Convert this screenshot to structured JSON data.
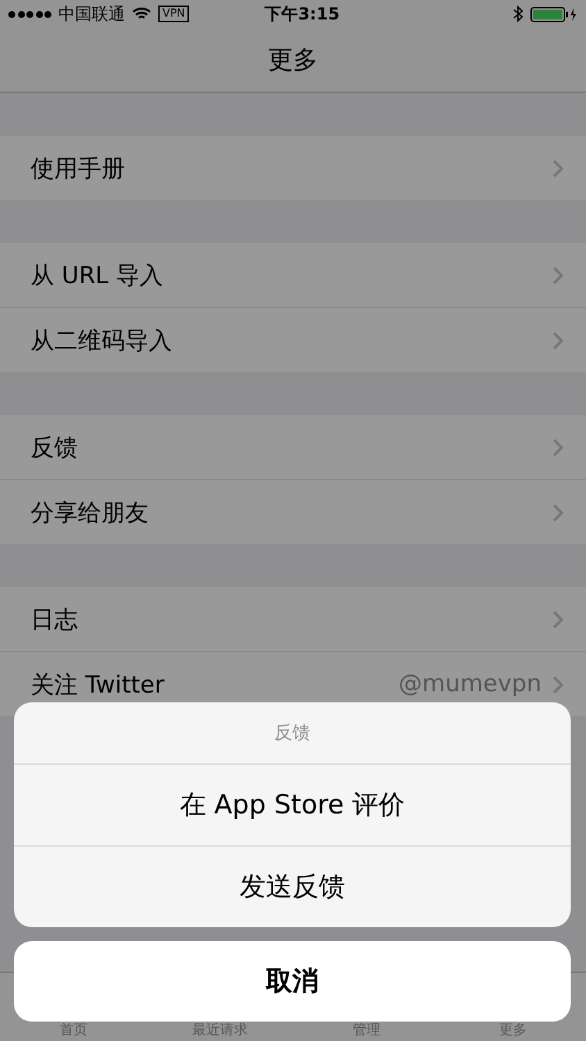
{
  "status_bar": {
    "carrier": "中国联通",
    "vpn": "VPN",
    "time": "下午3:15"
  },
  "nav_bar": {
    "title": "更多"
  },
  "sections": [
    {
      "rows": [
        {
          "label": "使用手册"
        }
      ]
    },
    {
      "rows": [
        {
          "label": "从 URL 导入"
        },
        {
          "label": "从二维码导入"
        }
      ]
    },
    {
      "rows": [
        {
          "label": "反馈"
        },
        {
          "label": "分享给朋友"
        }
      ]
    },
    {
      "rows": [
        {
          "label": "日志"
        },
        {
          "label": "关注 Twitter",
          "value": "@mumevpn"
        }
      ]
    }
  ],
  "tab_bar": [
    "首页",
    "最近请求",
    "管理",
    "更多"
  ],
  "action_sheet": {
    "title": "反馈",
    "actions": [
      "在 App Store 评价",
      "发送反馈"
    ],
    "cancel": "取消"
  }
}
